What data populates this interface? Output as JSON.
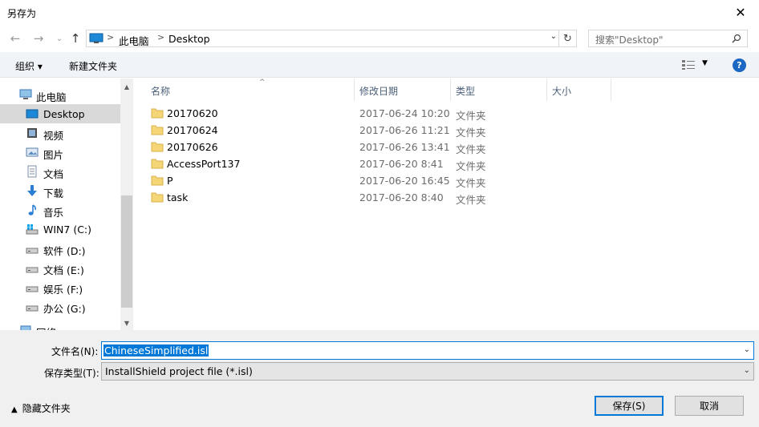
{
  "window": {
    "title": "另存为",
    "close_glyph": "✕"
  },
  "nav": {
    "back_glyph": "←",
    "forward_glyph": "→",
    "recent_glyph": "⌄",
    "up_glyph": "↑",
    "address": {
      "segments": [
        "此电脑",
        "Desktop"
      ],
      "separator": ">"
    },
    "refresh_glyph": "↻",
    "search_placeholder": "搜索\"Desktop\"",
    "search_icon": "search-icon"
  },
  "toolbar": {
    "organize_label": "组织 ▾",
    "new_folder_label": "新建文件夹",
    "help_label": "?"
  },
  "sidebar": {
    "items": [
      {
        "label": "此电脑",
        "icon": "computer-icon"
      },
      {
        "label": "Desktop",
        "icon": "desktop-icon",
        "selected": true
      },
      {
        "label": "视频",
        "icon": "video-icon"
      },
      {
        "label": "图片",
        "icon": "pictures-icon"
      },
      {
        "label": "文档",
        "icon": "documents-icon"
      },
      {
        "label": "下载",
        "icon": "download-icon"
      },
      {
        "label": "音乐",
        "icon": "music-icon"
      },
      {
        "label": "WIN7 (C:)",
        "icon": "system-drive-icon"
      },
      {
        "label": "软件 (D:)",
        "icon": "drive-icon"
      },
      {
        "label": "文档 (E:)",
        "icon": "drive-icon"
      },
      {
        "label": "娱乐 (F:)",
        "icon": "drive-icon"
      },
      {
        "label": "办公 (G:)",
        "icon": "drive-icon"
      },
      {
        "label": "网络",
        "icon": "network-icon"
      }
    ],
    "scroll_up_glyph": "▲",
    "scroll_down_glyph": "▼"
  },
  "files": {
    "columns": [
      "名称",
      "修改日期",
      "类型",
      "大小"
    ],
    "sort_glyph": "^",
    "rows": [
      {
        "name": "20170620",
        "date": "2017-06-24 10:20",
        "type": "文件夹"
      },
      {
        "name": "20170624",
        "date": "2017-06-26 11:21",
        "type": "文件夹"
      },
      {
        "name": "20170626",
        "date": "2017-06-26 13:41",
        "type": "文件夹"
      },
      {
        "name": "AccessPort137",
        "date": "2017-06-20 8:41",
        "type": "文件夹"
      },
      {
        "name": "P",
        "date": "2017-06-20 16:45",
        "type": "文件夹"
      },
      {
        "name": "task",
        "date": "2017-06-20 8:40",
        "type": "文件夹"
      }
    ]
  },
  "bottom": {
    "filename_label": "文件名(N):",
    "filename_value": "ChineseSimplified.isl",
    "filetype_label": "保存类型(T):",
    "filetype_value": "InstallShield project file (*.isl)",
    "hide_folders_label": "隐藏文件夹",
    "save_label": "保存(S)",
    "cancel_label": "取消",
    "dropdown_glyph": "⌄",
    "collapse_glyph": "▲"
  },
  "colors": {
    "accent": "#0078d7",
    "toolbar_bg": "#f0f4f9",
    "selected_bg": "#d9d9d9",
    "folder": "#f5d676"
  }
}
